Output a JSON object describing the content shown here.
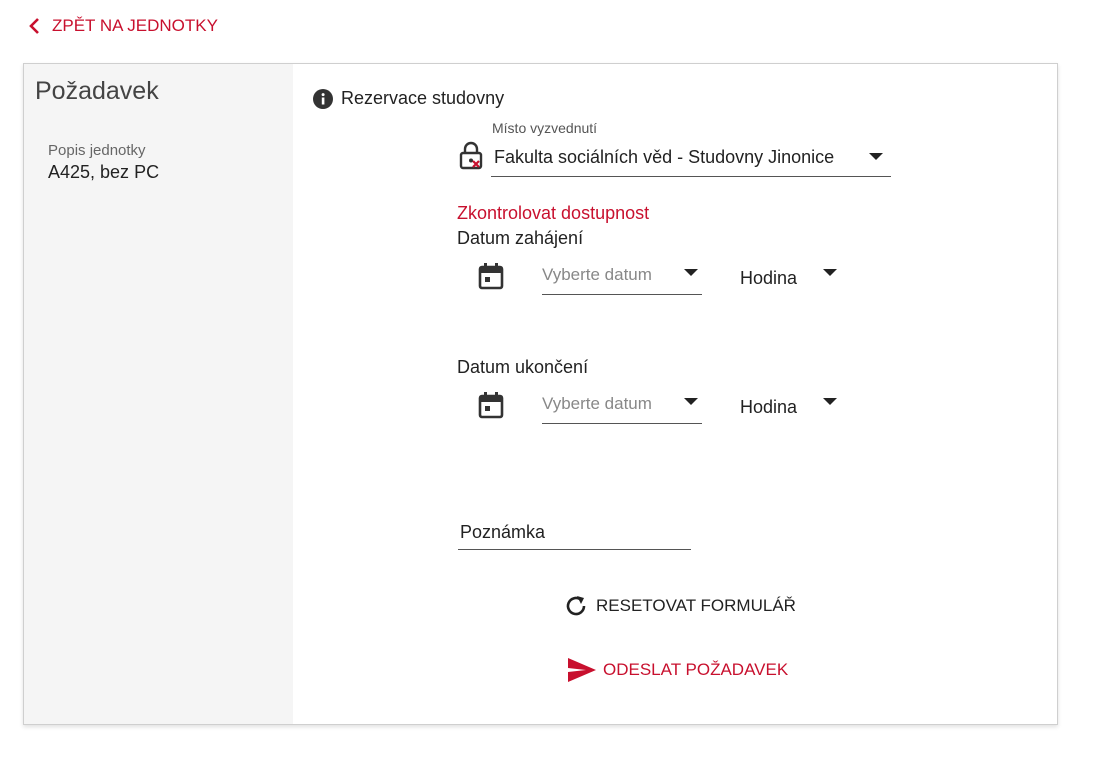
{
  "nav": {
    "back_label": "ZPĚT NA JEDNOTKY"
  },
  "sidebar": {
    "title": "Požadavek",
    "unit_label": "Popis jednotky",
    "unit_value": "A425, bez PC"
  },
  "form": {
    "info_text": "Rezervace studovny",
    "pickup": {
      "label": "Místo vyzvednutí",
      "value": "Fakulta sociálních věd - Studovny Jinonice"
    },
    "check_availability": "Zkontrolovat dostupnost",
    "start": {
      "label": "Datum zahájení",
      "date_placeholder": "Vyberte datum",
      "hour_label": "Hodina"
    },
    "end": {
      "label": "Datum ukončení",
      "date_placeholder": "Vyberte datum",
      "hour_label": "Hodina"
    },
    "note_label": "Poznámka",
    "reset_label": "RESETOVAT FORMULÁŘ",
    "submit_label": "ODESLAT POŽADAVEK"
  },
  "colors": {
    "accent": "#c8102e",
    "sidebar_bg": "#f5f5f5",
    "text": "#222222"
  },
  "icons": [
    "chevron-left-icon",
    "info-icon",
    "lock-icon",
    "calendar-icon",
    "refresh-icon",
    "send-icon"
  ]
}
